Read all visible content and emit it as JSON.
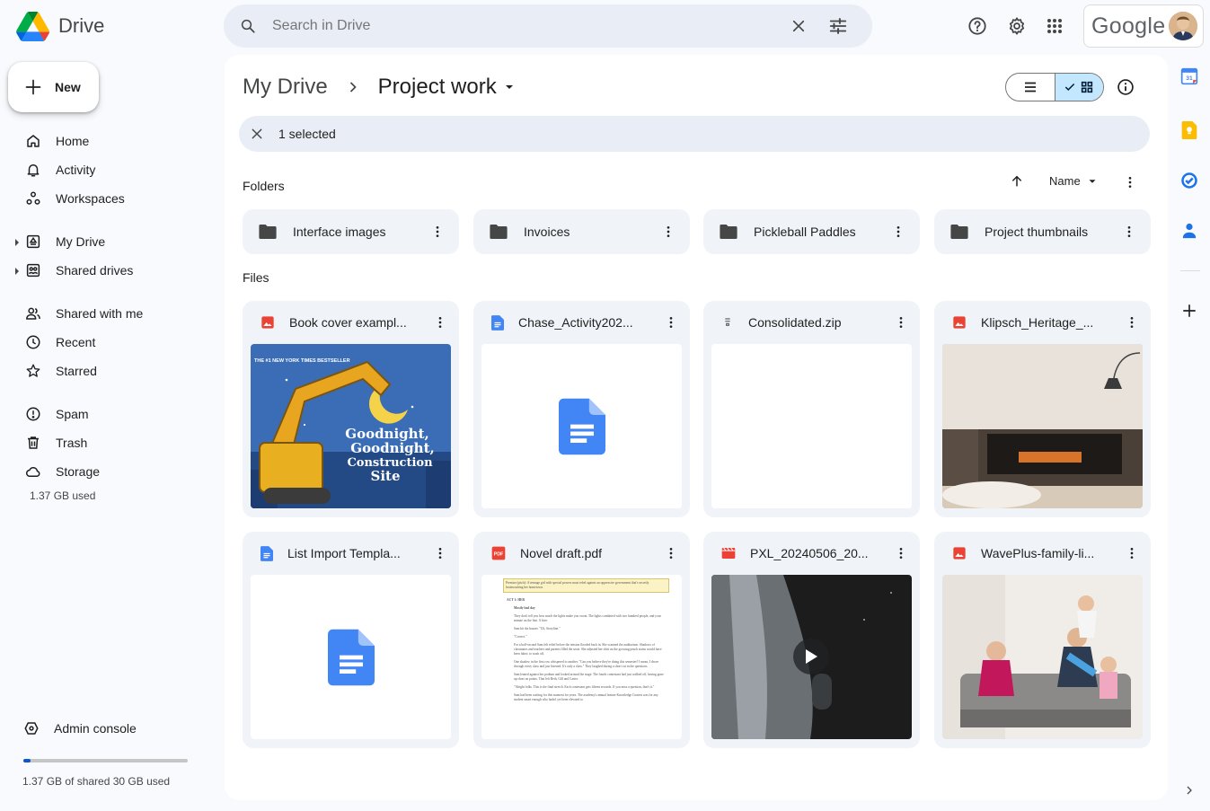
{
  "app": {
    "name": "Drive"
  },
  "search": {
    "placeholder": "Search in Drive"
  },
  "account": {
    "brand": "Google"
  },
  "new_button": {
    "label": "New"
  },
  "sidebar": {
    "items": [
      {
        "label": "Home",
        "icon": "home-icon"
      },
      {
        "label": "Activity",
        "icon": "bell-icon"
      },
      {
        "label": "Workspaces",
        "icon": "workspaces-icon"
      },
      {
        "label": "My Drive",
        "icon": "drive-icon"
      },
      {
        "label": "Shared drives",
        "icon": "shared-drives-icon"
      },
      {
        "label": "Shared with me",
        "icon": "people-icon"
      },
      {
        "label": "Recent",
        "icon": "clock-icon"
      },
      {
        "label": "Starred",
        "icon": "star-icon"
      },
      {
        "label": "Spam",
        "icon": "spam-icon"
      },
      {
        "label": "Trash",
        "icon": "trash-icon"
      },
      {
        "label": "Storage",
        "icon": "cloud-icon"
      }
    ],
    "storage_used": "1.37 GB used",
    "admin_label": "Admin console",
    "quota_text": "1.37 GB of shared 30 GB used",
    "quota_fraction": 0.046
  },
  "breadcrumb": {
    "root": "My Drive",
    "current": "Project work"
  },
  "selection": {
    "text": "1 selected"
  },
  "sort": {
    "label": "Name"
  },
  "sections": {
    "folders": "Folders",
    "files": "Files"
  },
  "folders": [
    {
      "name": "Interface images"
    },
    {
      "name": "Invoices"
    },
    {
      "name": "Pickleball Paddles"
    },
    {
      "name": "Project thumbnails"
    }
  ],
  "files": [
    {
      "name": "Book cover exampl...",
      "type": "image"
    },
    {
      "name": "Chase_Activity202...",
      "type": "doc"
    },
    {
      "name": "Consolidated.zip",
      "type": "zip"
    },
    {
      "name": "Klipsch_Heritage_...",
      "type": "image"
    },
    {
      "name": "List Import Templa...",
      "type": "doc"
    },
    {
      "name": "Novel draft.pdf",
      "type": "pdf"
    },
    {
      "name": "PXL_20240506_20...",
      "type": "video"
    },
    {
      "name": "WavePlus-family-li...",
      "type": "image"
    }
  ],
  "book_cover": {
    "banner": "THE #1 NEW YORK TIMES BESTSELLER",
    "title_lines": [
      "Goodnight,",
      "Goodnight,",
      "Construction",
      "Site"
    ]
  },
  "pdf_preview": {
    "highlight": "Premise (pitch): A teenage girl with special powers must rebel against an oppressive government that's secretly brainwashing her hometown.",
    "act": "ACT 1: HER",
    "heading": "Mostly bad day",
    "paras": [
      "They don't tell you how much the lights make you sweat. The lights combined with two hundred people, and your minute on the line. A hive.",
      "Sam hit the buzzer. \"Uh, Storyline.\"",
      "\"Correct.\"",
      "For a half-second Sam felt relief before the tension flooded back in. She scanned the auditorium. Shadows of classmates and teachers and parents filled the seats. She adjusted her shirt on the growing peach stains would have been fabric to wash off.",
      "One shadow in the first row whispered to another. \"Can you believe they're doing this semester? I mean, I drove through every class and just listened. It's only a class.\" They laughed during a short cut in the questions.",
      "Sam leaned against her podium and looked around the stage. The fourth contestant had just walked off, having gone up short on points. That left Beth, Gill and Carter.",
      "\"Alright folks. This is the final stretch. Each contestant gets fifteen seconds. If you miss a question, that's it.\"",
      "Sam had been waiting for this moment for years. The academy's annual feature Knowledge Contest was for any student smart enough who hadn't yet been elevated to"
    ]
  },
  "colors": {
    "accent": "#0b57d0",
    "selected_bg": "#c2e7ff",
    "surface": "#f0f4f9"
  }
}
